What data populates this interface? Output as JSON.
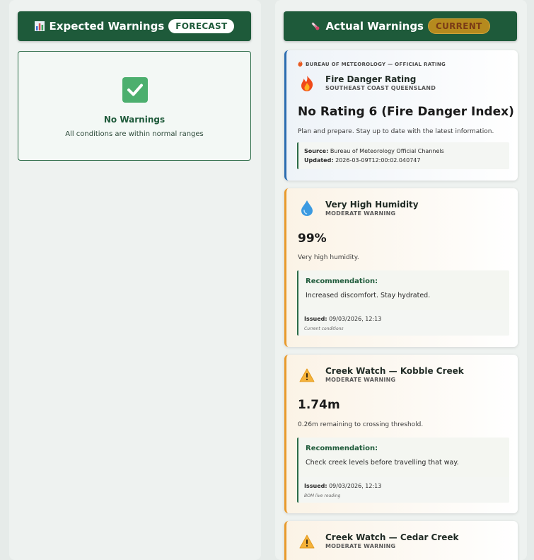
{
  "expected": {
    "header_title": "Expected Warnings",
    "header_icon": "bar-chart-icon",
    "badge": "FORECAST",
    "empty_title": "No Warnings",
    "empty_subtitle": "All conditions are within normal ranges",
    "empty_icon": "check-icon"
  },
  "actual": {
    "header_title": "Actual Warnings",
    "header_icon": "thermometer-icon",
    "badge": "CURRENT",
    "cards": [
      {
        "source_tag": "BUREAU OF METEOROLOGY — OFFICIAL RATING",
        "icon": "fire-icon",
        "title": "Fire Danger Rating",
        "subtitle": "SOUTHEAST COAST QUEENSLAND",
        "value": "No Rating 6 (Fire Danger Index)",
        "description": "Plan and prepare. Stay up to date with the latest information.",
        "meta_label_1": "Source:",
        "meta_value_1": "Bureau of Meteorology Official Channels",
        "meta_label_2": "Updated:",
        "meta_value_2": "2026-03-09T12:00:02.040747"
      },
      {
        "icon": "droplet-icon",
        "title": "Very High Humidity",
        "subtitle": "MODERATE WARNING",
        "value": "99%",
        "description": "Very high humidity.",
        "rec_label": "Recommendation:",
        "rec_text": "Increased discomfort. Stay hydrated.",
        "issued_label": "Issued:",
        "issued_value": "09/03/2026, 12:13",
        "note": "Current conditions"
      },
      {
        "icon": "warning-icon",
        "title": "Creek Watch — Kobble Creek",
        "subtitle": "MODERATE WARNING",
        "value": "1.74m",
        "description": "0.26m remaining to crossing threshold.",
        "rec_label": "Recommendation:",
        "rec_text": "Check creek levels before travelling that way.",
        "issued_label": "Issued:",
        "issued_value": "09/03/2026, 12:13",
        "note": "BOM live reading"
      },
      {
        "icon": "warning-icon",
        "title": "Creek Watch — Cedar Creek",
        "subtitle": "MODERATE WARNING"
      }
    ]
  },
  "colors": {
    "header_bg": "#1e5a3a",
    "accent_orange": "#e89a2c",
    "accent_blue": "#2b6cb0"
  }
}
